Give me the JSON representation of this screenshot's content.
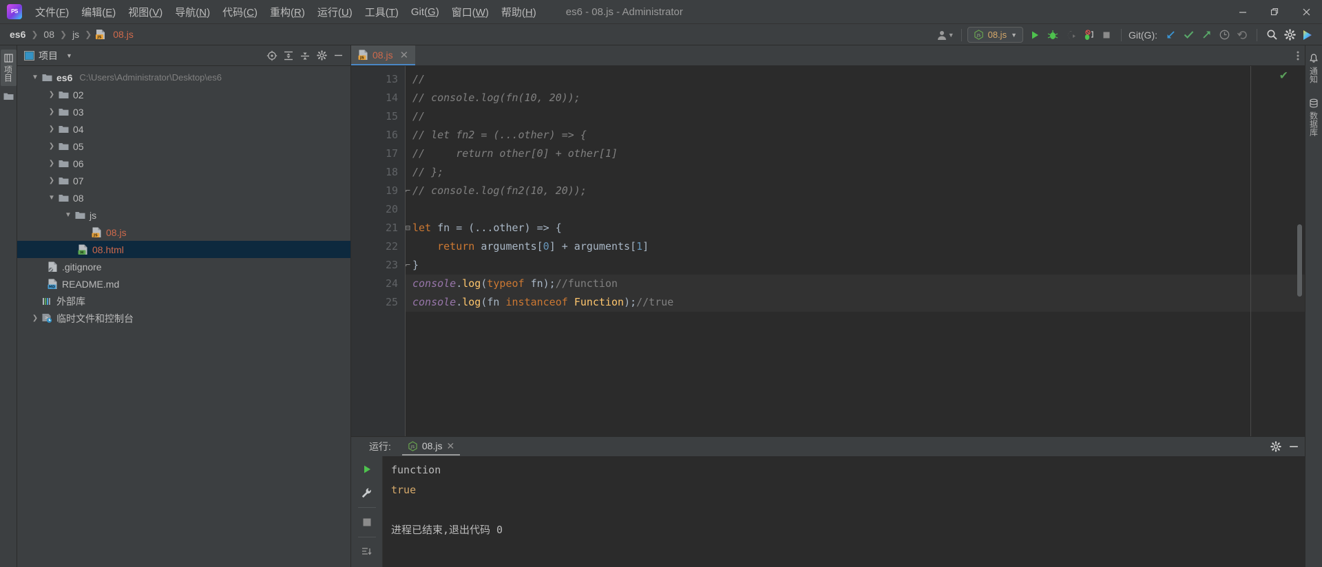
{
  "titlebar": {
    "logo_text": "PS",
    "menu": [
      {
        "label": "文件",
        "accel": "F"
      },
      {
        "label": "编辑",
        "accel": "E"
      },
      {
        "label": "视图",
        "accel": "V"
      },
      {
        "label": "导航",
        "accel": "N"
      },
      {
        "label": "代码",
        "accel": "C"
      },
      {
        "label": "重构",
        "accel": "R"
      },
      {
        "label": "运行",
        "accel": "U"
      },
      {
        "label": "工具",
        "accel": "T"
      },
      {
        "label": "Git",
        "accel": "G"
      },
      {
        "label": "窗口",
        "accel": "W"
      },
      {
        "label": "帮助",
        "accel": "H"
      }
    ],
    "window_title": "es6 - 08.js - Administrator",
    "minimize": "—",
    "maximize": "❐",
    "close": "✕"
  },
  "navbar": {
    "breadcrumbs": [
      "es6",
      "08",
      "js",
      "08.js"
    ],
    "separator": "❯",
    "run_config": "08.js",
    "git_label": "Git(G):",
    "buttons": {
      "run": "运行",
      "debug": "调试",
      "run_coverage": "运行并覆盖",
      "profile": "性能分析",
      "stop": "停止",
      "update_project": "更新项目",
      "commit": "提交",
      "push": "推送",
      "history": "历史记录",
      "rollback": "回滚",
      "search_everywhere": "全局搜索",
      "settings": "设置"
    }
  },
  "left_toolbar": {
    "project_tab": "项目"
  },
  "project_panel": {
    "title": "项目",
    "tree": [
      {
        "depth": 0,
        "arrow": "down",
        "icon": "folder",
        "name": "es6",
        "path": "C:\\Users\\Administrator\\Desktop\\es6",
        "bold": true,
        "selected": false
      },
      {
        "depth": 1,
        "arrow": "right",
        "icon": "folder",
        "name": "02",
        "path": "",
        "bold": false,
        "selected": false
      },
      {
        "depth": 1,
        "arrow": "right",
        "icon": "folder",
        "name": "03",
        "path": "",
        "bold": false,
        "selected": false
      },
      {
        "depth": 1,
        "arrow": "right",
        "icon": "folder",
        "name": "04",
        "path": "",
        "bold": false,
        "selected": false
      },
      {
        "depth": 1,
        "arrow": "right",
        "icon": "folder",
        "name": "05",
        "path": "",
        "bold": false,
        "selected": false
      },
      {
        "depth": 1,
        "arrow": "right",
        "icon": "folder",
        "name": "06",
        "path": "",
        "bold": false,
        "selected": false
      },
      {
        "depth": 1,
        "arrow": "right",
        "icon": "folder",
        "name": "07",
        "path": "",
        "bold": false,
        "selected": false
      },
      {
        "depth": 1,
        "arrow": "down",
        "icon": "folder",
        "name": "08",
        "path": "",
        "bold": false,
        "selected": false
      },
      {
        "depth": 2,
        "arrow": "down",
        "icon": "folder",
        "name": "js",
        "path": "",
        "bold": false,
        "selected": false
      },
      {
        "depth": 3,
        "arrow": "none",
        "icon": "js",
        "name": "08.js",
        "path": "",
        "bold": false,
        "selected": false,
        "red": true
      },
      {
        "depth": 2,
        "arrow": "none",
        "icon": "html",
        "name": "08.html",
        "path": "",
        "bold": false,
        "selected": true,
        "red": true
      },
      {
        "depth": 1,
        "arrow": "none",
        "icon": "gitignore",
        "name": ".gitignore",
        "path": "",
        "bold": false,
        "selected": false
      },
      {
        "depth": 1,
        "arrow": "none",
        "icon": "md",
        "name": "README.md",
        "path": "",
        "bold": false,
        "selected": false
      },
      {
        "depth": 0,
        "arrow": "none",
        "icon": "lib",
        "name": "外部库",
        "path": "",
        "bold": false,
        "selected": false
      },
      {
        "depth": 0,
        "arrow": "right",
        "icon": "scratch",
        "name": "临时文件和控制台",
        "path": "",
        "bold": false,
        "selected": false
      }
    ]
  },
  "editor": {
    "tab": {
      "label": "08.js",
      "close": "✕"
    },
    "first_line_number": 13,
    "lines": [
      {
        "n": 13,
        "fold": "",
        "highlight": false,
        "tokens": [
          {
            "t": "// ",
            "c": "cmt"
          }
        ]
      },
      {
        "n": 14,
        "fold": "",
        "highlight": false,
        "tokens": [
          {
            "t": "// console.log(fn(10, 20));",
            "c": "cmt"
          }
        ]
      },
      {
        "n": 15,
        "fold": "",
        "highlight": false,
        "tokens": [
          {
            "t": "//",
            "c": "cmt"
          }
        ]
      },
      {
        "n": 16,
        "fold": "",
        "highlight": false,
        "tokens": [
          {
            "t": "// let fn2 = (...other) => {",
            "c": "cmt"
          }
        ]
      },
      {
        "n": 17,
        "fold": "",
        "highlight": false,
        "tokens": [
          {
            "t": "//     return other[0] + other[1]",
            "c": "cmt"
          }
        ]
      },
      {
        "n": 18,
        "fold": "",
        "highlight": false,
        "tokens": [
          {
            "t": "// };",
            "c": "cmt"
          }
        ]
      },
      {
        "n": 19,
        "fold": "end",
        "highlight": false,
        "tokens": [
          {
            "t": "// console.log(fn2(10, 20));",
            "c": "cmt"
          }
        ]
      },
      {
        "n": 20,
        "fold": "",
        "highlight": false,
        "tokens": [
          {
            "t": "",
            "c": "txt"
          }
        ]
      },
      {
        "n": 21,
        "fold": "start",
        "highlight": false,
        "tokens": [
          {
            "t": "let",
            "c": "kw"
          },
          {
            "t": " fn = (...other) => {",
            "c": "txt"
          }
        ]
      },
      {
        "n": 22,
        "fold": "",
        "highlight": false,
        "tokens": [
          {
            "t": "    ",
            "c": "txt"
          },
          {
            "t": "return",
            "c": "kw"
          },
          {
            "t": " arguments[",
            "c": "txt"
          },
          {
            "t": "0",
            "c": "num"
          },
          {
            "t": "] + arguments[",
            "c": "txt"
          },
          {
            "t": "1",
            "c": "num"
          },
          {
            "t": "]",
            "c": "txt"
          }
        ]
      },
      {
        "n": 23,
        "fold": "end",
        "highlight": false,
        "tokens": [
          {
            "t": "}",
            "c": "txt"
          }
        ]
      },
      {
        "n": 24,
        "fold": "",
        "highlight": true,
        "tokens": [
          {
            "t": "console",
            "c": "obj"
          },
          {
            "t": ".",
            "c": "txt"
          },
          {
            "t": "log",
            "c": "fnc"
          },
          {
            "t": "(",
            "c": "txt"
          },
          {
            "t": "typeof",
            "c": "kw"
          },
          {
            "t": " fn);",
            "c": "txt"
          },
          {
            "t": "//function",
            "c": "cmt2"
          }
        ]
      },
      {
        "n": 25,
        "fold": "",
        "highlight": true,
        "tokens": [
          {
            "t": "console",
            "c": "obj"
          },
          {
            "t": ".",
            "c": "txt"
          },
          {
            "t": "log",
            "c": "fnc"
          },
          {
            "t": "(fn ",
            "c": "txt"
          },
          {
            "t": "instanceof",
            "c": "kw"
          },
          {
            "t": " ",
            "c": "txt"
          },
          {
            "t": "Function",
            "c": "fnc"
          },
          {
            "t": ");",
            "c": "txt"
          },
          {
            "t": "//true",
            "c": "cmt2"
          }
        ]
      }
    ],
    "inspection_status": "✔"
  },
  "run_panel": {
    "label": "运行:",
    "tab_label": "08.js",
    "tab_close": "✕",
    "settings_icon": "gear-icon",
    "minimize_icon": "—",
    "console_lines": [
      {
        "text": "function",
        "color": "default"
      },
      {
        "text": "true",
        "color": "orange"
      },
      {
        "text": "",
        "color": "default"
      },
      {
        "text": "进程已结束,退出代码 0",
        "color": "default"
      }
    ]
  },
  "right_toolbar": {
    "tabs": [
      {
        "label": "通知",
        "icon": "bell-icon"
      },
      {
        "label": "数据库",
        "icon": "database-icon"
      }
    ]
  },
  "colors": {
    "bg": "#3c3f41",
    "editor_bg": "#2b2b2b",
    "accent_blue": "#4a88c7",
    "selection": "#0d293e",
    "file_red": "#cf6a4c",
    "keyword_orange": "#cc7832",
    "string_green": "#6a8759",
    "number_blue": "#6897bb",
    "function_yellow": "#ffc66d",
    "object_purple": "#9876aa",
    "comment_gray": "#808080"
  }
}
